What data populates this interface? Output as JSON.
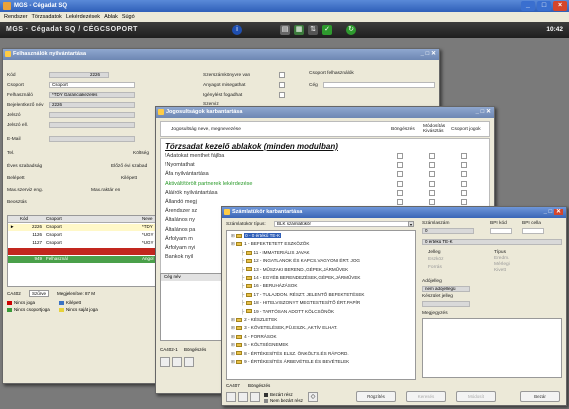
{
  "window": {
    "title": "MGS - Cégadat SQ"
  },
  "menu": [
    "Rendszer",
    "Törzsadatok",
    "Lekérdezések",
    "Ablak",
    "Súgó"
  ],
  "appbar": {
    "title": "MGS · Cégadat SQ / CÉGCSOPORT",
    "clock": "10:42"
  },
  "user_window": {
    "title": "Felhasználók nyilvántartása",
    "fields": {
      "kod_label": "Kód",
      "kod_value": "2226",
      "csoport_label": "Csoport",
      "csoport_value": "Csoport",
      "felhasznalo_label": "Felhasználó",
      "felhasznalo_value": "*TDY Garanciakezelés",
      "bejelentkezo_label": "Bejelentkező név",
      "bejelentkezo_value": "2226",
      "jelszo_label": "Jelszó",
      "jelszo_ell_label": "Jelszó ell.",
      "email_label": "E-Mail",
      "tel_label": "Tel.",
      "eves_label": "Éves szabadság",
      "belepett_label": "Belépett",
      "max_label": "Max.szerviz eng.",
      "beosztas_label": "Beosztás",
      "szerszam_label": "Szerszámkönyvre van",
      "anyagot_label": "Anyagot misegathat",
      "igenyles_label": "Igénylést fogadhat",
      "szerviz_label": "Szerviz",
      "felh_csop_label": "Csoport felhasználók",
      "ceg_label": "Cég",
      "kiltseg_label": "Költség",
      "elozo_label": "Előző évi szabad",
      "kilepett_label": "Kilépett",
      "max_raktar_label": "Max.raktár en"
    },
    "grid": {
      "headers": [
        "Kód",
        "Csoport",
        "Neve"
      ],
      "rows": [
        {
          "kod": "2226",
          "csoport": "Csoport",
          "neve": "*TDY",
          "style": "active"
        },
        {
          "kod": "1126",
          "csoport": "Csoport",
          "neve": "*UGY",
          "style": "normal"
        },
        {
          "kod": "1127",
          "csoport": "Csoport",
          "neve": "*UGY",
          "style": "normal"
        },
        {
          "kod": "",
          "csoport": "",
          "neve": "",
          "style": "red"
        },
        {
          "kod": "949",
          "csoport": "Felhasznál",
          "neve": "Angol",
          "style": "green"
        }
      ]
    },
    "status": {
      "code": "CA402",
      "szures": "Szűrve",
      "megjelenitve": "Megjelenítve: 87 M"
    },
    "legend": {
      "nincs_joga": "Nincs joga",
      "nincs_csop": "Nincs csoportjoga",
      "kilepett": "Kilépett",
      "nincs_sajat": "Nincs saját joga"
    }
  },
  "rights_window": {
    "title": "Jogosultságok karbantartása",
    "header": {
      "name": "Jogosultság neve, megnevezése",
      "bongeszas": "Böngészés",
      "modositas": "Módosítás Kivásztás",
      "csoport": "Csoport jogok"
    },
    "group_title": "Törzsadat kezelő ablakok (minden modulban)",
    "items": [
      {
        "label": "!Adatokat menthet fájlba",
        "color": "normal"
      },
      {
        "label": "!Nyomtathat",
        "color": "normal"
      },
      {
        "label": "Áfa nyilvántartása",
        "color": "normal"
      },
      {
        "label": "Aktivált/törölt partnerek lekérdezése",
        "color": "green"
      },
      {
        "label": "Aláírók nyilvántartása",
        "color": "normal"
      },
      {
        "label": "Állandó megj",
        "color": "normal"
      },
      {
        "label": "Árendszer sz",
        "color": "normal"
      },
      {
        "label": "Általános ny",
        "color": "normal"
      },
      {
        "label": "Általános pa",
        "color": "normal"
      },
      {
        "label": "Árfolyam m",
        "color": "normal"
      },
      {
        "label": "Árfolyam nyi",
        "color": "normal"
      },
      {
        "label": "Bankok nyil",
        "color": "normal"
      }
    ],
    "left_header": "Cég név",
    "status": {
      "code": "CA402-1",
      "bongeszas": "Böngészés"
    }
  },
  "tree_window": {
    "title": "Számlatükör karbantartása",
    "selector_label": "Számlatükör típus:",
    "selector_value": "BLK számlatükör",
    "nodes": [
      {
        "label": "0 - 0 értékű TE-K",
        "level": 0,
        "active": true
      },
      {
        "label": "1 - BEFEKTETETT ESZKÖZÖK",
        "level": 0,
        "active": false
      },
      {
        "label": "11 - IMMATERIÁLIS JAVAK",
        "level": 1,
        "active": false
      },
      {
        "label": "12 - INGATLANOK ÉS KAPCS.VAGYONI ÉRT. JOG",
        "level": 1,
        "active": false
      },
      {
        "label": "13 - MŰSZAKI BEREND.,GÉPEK,JÁRMŰVEK",
        "level": 1,
        "active": false
      },
      {
        "label": "14 - EGYÉB BERENDEZÉSEK,GÉPEK,JÁRMŰVEK",
        "level": 1,
        "active": false
      },
      {
        "label": "16 - BERUHÁZÁSOK",
        "level": 1,
        "active": false
      },
      {
        "label": "17 - TULAJDON. RÉSZT. JELENTŐ BEFEKTETÉSEK",
        "level": 1,
        "active": false
      },
      {
        "label": "18 - HITELVISZONYT MEGTESTESÍTŐ ÉRT.PAPÍR",
        "level": 1,
        "active": false
      },
      {
        "label": "19 - TARTÓSAN ADOTT KÖLCSÖNÖK",
        "level": 1,
        "active": false
      },
      {
        "label": "2 - KÉSZLETEK",
        "level": 0,
        "active": false
      },
      {
        "label": "3 - KÖVETELÉSEK,PÜ.ESZK.,AKTÍV ELHAT.",
        "level": 0,
        "active": false
      },
      {
        "label": "4 - FORRÁSOK",
        "level": 0,
        "active": false
      },
      {
        "label": "5 - KÖLTSÉGNEMEK",
        "level": 0,
        "active": false
      },
      {
        "label": "8 - ÉRTÉKESÍTÉS ELSZ. ÖNKÖLTS.ÉS RÁFORD.",
        "level": 0,
        "active": false
      },
      {
        "label": "9 - ÉRTÉKESÍTÉS ÁRBEVÉTELE ÉS BEVÉTELEK",
        "level": 0,
        "active": false
      }
    ],
    "right": {
      "szamlaszam_label": "Számlaszám",
      "szamlaszam_value": "0",
      "bpi_kod_label": "BPI kód",
      "bpi_cella_label": "BPI cella",
      "name_value": "0 értékű TE-K",
      "jelleg_label": "Jelleg",
      "jelleg_opts": [
        "Eszköz",
        "Forrás"
      ],
      "tipus_label": "Típus",
      "tipus_opts": [
        "Eredm.",
        "Mérlegi",
        "Kivett"
      ],
      "adojelleg_label": "Adójelleg",
      "adojelleg_value": "nem adójellegű",
      "keszulet_label": "Készület jelleg",
      "megjegyzes_label": "Megjegyzés"
    },
    "status": {
      "code": "CA407",
      "bongeszas": "Böngészés"
    },
    "footer": {
      "bezart": "Bezárt rész",
      "nem_bezart": "Nem bezárt rész",
      "rogzites": "Rögzítés",
      "kereses": "Keresés",
      "modosit": "Módosít",
      "bezar": "Bezár"
    }
  }
}
